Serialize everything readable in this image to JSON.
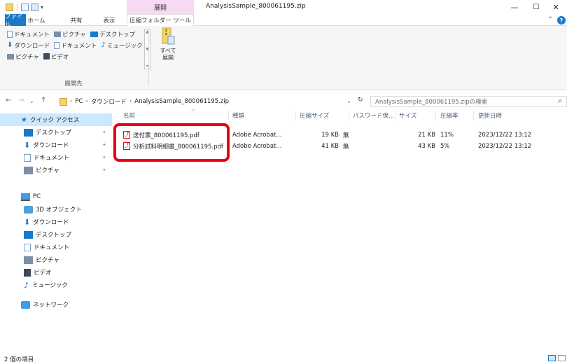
{
  "window": {
    "title": "AnalysisSample_800061195.zip",
    "context_tab_group": "展開",
    "minimize": "—",
    "maximize": "☐",
    "close": "✕"
  },
  "ribbon_tabs": {
    "file": "ファイル",
    "home": "ホーム",
    "share": "共有",
    "view": "表示",
    "compressed_tools": "圧縮フォルダー ツール"
  },
  "ribbon": {
    "destinations_row1": [
      "ドキュメント",
      "ピクチャ",
      "デスクトップ"
    ],
    "destinations_row2": [
      "ダウンロード",
      "ドキュメント",
      "ミュージック"
    ],
    "destinations_row3": [
      "ピクチャ",
      "ビデオ"
    ],
    "extract_all_line1": "すべて",
    "extract_all_line2": "展開",
    "group_label": "展開先"
  },
  "address": {
    "crumbs": [
      "PC",
      "ダウンロード",
      "AnalysisSample_800061195.zip"
    ],
    "search_placeholder": "AnalysisSample_800061195.zipの検索"
  },
  "sidebar": {
    "quick_access": "クイック アクセス",
    "quick_items": [
      "デスクトップ",
      "ダウンロード",
      "ドキュメント",
      "ピクチャ"
    ],
    "pc": "PC",
    "pc_items": [
      "3D オブジェクト",
      "ダウンロード",
      "デスクトップ",
      "ドキュメント",
      "ピクチャ",
      "ビデオ",
      "ミュージック"
    ],
    "network": "ネットワーク"
  },
  "columns": {
    "name": "名前",
    "type": "種類",
    "compressed_size": "圧縮サイズ",
    "password": "パスワード保...",
    "size": "サイズ",
    "ratio": "圧縮率",
    "modified": "更新日時"
  },
  "files": [
    {
      "name": "送付票_800061195.pdf",
      "type": "Adobe Acrobat...",
      "compressed_size": "19 KB",
      "password": "無",
      "size": "21 KB",
      "ratio": "11%",
      "modified": "2023/12/22 13:12"
    },
    {
      "name": "分析試料明細書_800061195.pdf",
      "type": "Adobe Acrobat...",
      "compressed_size": "41 KB",
      "password": "無",
      "size": "43 KB",
      "ratio": "5%",
      "modified": "2023/12/22 13:12"
    }
  ],
  "status": {
    "item_count": "2 個の項目"
  },
  "colors": {
    "accent": "#1979ca",
    "context_tab": "#f6d9f3",
    "highlight": "#e50012",
    "selected": "#cce8ff"
  }
}
